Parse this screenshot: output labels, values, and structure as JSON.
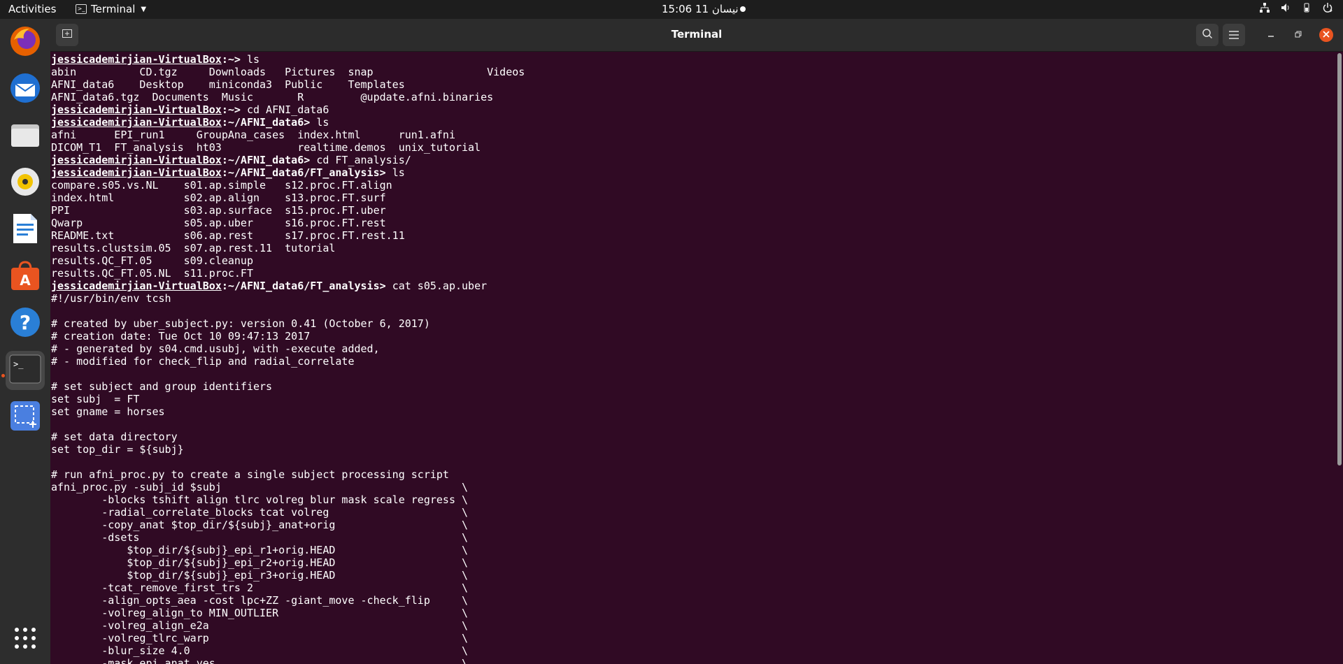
{
  "topbar": {
    "activities": "Activities",
    "app_name": "Terminal",
    "clock": "15:06  نيسان 11"
  },
  "dock": {
    "items": [
      {
        "name": "firefox-icon"
      },
      {
        "name": "thunderbird-icon"
      },
      {
        "name": "files-icon"
      },
      {
        "name": "rhythmbox-icon"
      },
      {
        "name": "libreoffice-writer-icon"
      },
      {
        "name": "software-center-icon"
      },
      {
        "name": "help-icon"
      },
      {
        "name": "terminal-icon"
      },
      {
        "name": "screenshot-icon"
      },
      {
        "name": "show-apps-icon"
      }
    ]
  },
  "window": {
    "title": "Terminal"
  },
  "terminal": {
    "user": "jessicademirjian-VirtualBox",
    "lines": [
      {
        "type": "prompt",
        "path": ":~> ",
        "cmd": "ls"
      },
      {
        "type": "out",
        "text": "abin          CD.tgz     Downloads   Pictures  snap                  Videos"
      },
      {
        "type": "out",
        "text": "AFNI_data6    Desktop    miniconda3  Public    Templates"
      },
      {
        "type": "out",
        "text": "AFNI_data6.tgz  Documents  Music       R         @update.afni.binaries"
      },
      {
        "type": "prompt",
        "path": ":~> ",
        "cmd": "cd AFNI_data6"
      },
      {
        "type": "prompt",
        "path": ":~/AFNI_data6> ",
        "cmd": "ls"
      },
      {
        "type": "out",
        "text": "afni      EPI_run1     GroupAna_cases  index.html      run1.afni"
      },
      {
        "type": "out",
        "text": "DICOM_T1  FT_analysis  ht03            realtime.demos  unix_tutorial"
      },
      {
        "type": "prompt",
        "path": ":~/AFNI_data6> ",
        "cmd": "cd FT_analysis/"
      },
      {
        "type": "prompt",
        "path": ":~/AFNI_data6/FT_analysis> ",
        "cmd": "ls"
      },
      {
        "type": "out",
        "text": "compare.s05.vs.NL    s01.ap.simple   s12.proc.FT.align"
      },
      {
        "type": "out",
        "text": "index.html           s02.ap.align    s13.proc.FT.surf"
      },
      {
        "type": "out",
        "text": "PPI                  s03.ap.surface  s15.proc.FT.uber"
      },
      {
        "type": "out",
        "text": "Qwarp                s05.ap.uber     s16.proc.FT.rest"
      },
      {
        "type": "out",
        "text": "README.txt           s06.ap.rest     s17.proc.FT.rest.11"
      },
      {
        "type": "out",
        "text": "results.clustsim.05  s07.ap.rest.11  tutorial"
      },
      {
        "type": "out",
        "text": "results.QC_FT.05     s09.cleanup"
      },
      {
        "type": "out",
        "text": "results.QC_FT.05.NL  s11.proc.FT"
      },
      {
        "type": "prompt",
        "path": ":~/AFNI_data6/FT_analysis> ",
        "cmd": "cat s05.ap.uber"
      },
      {
        "type": "out",
        "text": "#!/usr/bin/env tcsh"
      },
      {
        "type": "out",
        "text": ""
      },
      {
        "type": "out",
        "text": "# created by uber_subject.py: version 0.41 (October 6, 2017)"
      },
      {
        "type": "out",
        "text": "# creation date: Tue Oct 10 09:47:13 2017"
      },
      {
        "type": "out",
        "text": "# - generated by s04.cmd.usubj, with -execute added,"
      },
      {
        "type": "out",
        "text": "# - modified for check_flip and radial_correlate"
      },
      {
        "type": "out",
        "text": ""
      },
      {
        "type": "out",
        "text": "# set subject and group identifiers"
      },
      {
        "type": "out",
        "text": "set subj  = FT"
      },
      {
        "type": "out",
        "text": "set gname = horses"
      },
      {
        "type": "out",
        "text": ""
      },
      {
        "type": "out",
        "text": "# set data directory"
      },
      {
        "type": "out",
        "text": "set top_dir = ${subj}"
      },
      {
        "type": "out",
        "text": ""
      },
      {
        "type": "out",
        "text": "# run afni_proc.py to create a single subject processing script"
      },
      {
        "type": "out",
        "text": "afni_proc.py -subj_id $subj                                      \\"
      },
      {
        "type": "out",
        "text": "        -blocks tshift align tlrc volreg blur mask scale regress \\"
      },
      {
        "type": "out",
        "text": "        -radial_correlate_blocks tcat volreg                     \\"
      },
      {
        "type": "out",
        "text": "        -copy_anat $top_dir/${subj}_anat+orig                    \\"
      },
      {
        "type": "out",
        "text": "        -dsets                                                   \\"
      },
      {
        "type": "out",
        "text": "            $top_dir/${subj}_epi_r1+orig.HEAD                    \\"
      },
      {
        "type": "out",
        "text": "            $top_dir/${subj}_epi_r2+orig.HEAD                    \\"
      },
      {
        "type": "out",
        "text": "            $top_dir/${subj}_epi_r3+orig.HEAD                    \\"
      },
      {
        "type": "out",
        "text": "        -tcat_remove_first_trs 2                                 \\"
      },
      {
        "type": "out",
        "text": "        -align_opts_aea -cost lpc+ZZ -giant_move -check_flip     \\"
      },
      {
        "type": "out",
        "text": "        -volreg_align_to MIN_OUTLIER                             \\"
      },
      {
        "type": "out",
        "text": "        -volreg_align_e2a                                        \\"
      },
      {
        "type": "out",
        "text": "        -volreg_tlrc_warp                                        \\"
      },
      {
        "type": "out",
        "text": "        -blur_size 4.0                                           \\"
      },
      {
        "type": "out",
        "text": "        -mask_epi_anat yes                                       \\"
      }
    ]
  }
}
